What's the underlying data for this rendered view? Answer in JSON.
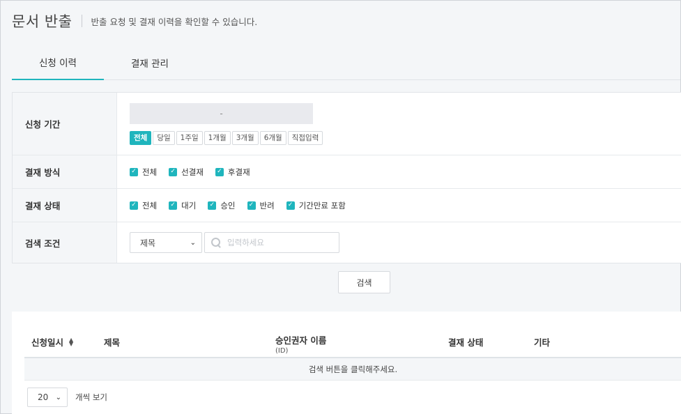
{
  "header": {
    "title": "문서 반출",
    "description": "반출 요청 및 결재 이력을 확인할 수 있습니다."
  },
  "tabs": [
    {
      "label": "신청 이력",
      "active": true
    },
    {
      "label": "결재 관리",
      "active": false
    }
  ],
  "filters": {
    "period": {
      "label": "신청 기간",
      "range_separator": "-",
      "buttons": [
        "전체",
        "당일",
        "1주일",
        "1개월",
        "3개월",
        "6개월",
        "직접입력"
      ],
      "active_index": 0
    },
    "payment_method": {
      "label": "결재 방식",
      "options": [
        "전체",
        "선결재",
        "후결재"
      ]
    },
    "payment_status": {
      "label": "결재 상태",
      "options": [
        "전체",
        "대기",
        "승인",
        "반려",
        "기간만료 포함"
      ]
    },
    "search_condition": {
      "label": "검색 조건",
      "select_value": "제목",
      "input_placeholder": "입력하세요"
    }
  },
  "search_button": "검색",
  "table": {
    "columns": {
      "date": "신청일시",
      "title": "제목",
      "approver": "승인권자 이름",
      "approver_sub": "(ID)",
      "status": "결재 상태",
      "etc": "기타"
    },
    "empty_message": "검색 버튼을 클릭해주세요."
  },
  "pagination": {
    "page_size": "20",
    "page_size_label": "개씩 보기"
  },
  "colors": {
    "accent": "#1fb5bd"
  }
}
